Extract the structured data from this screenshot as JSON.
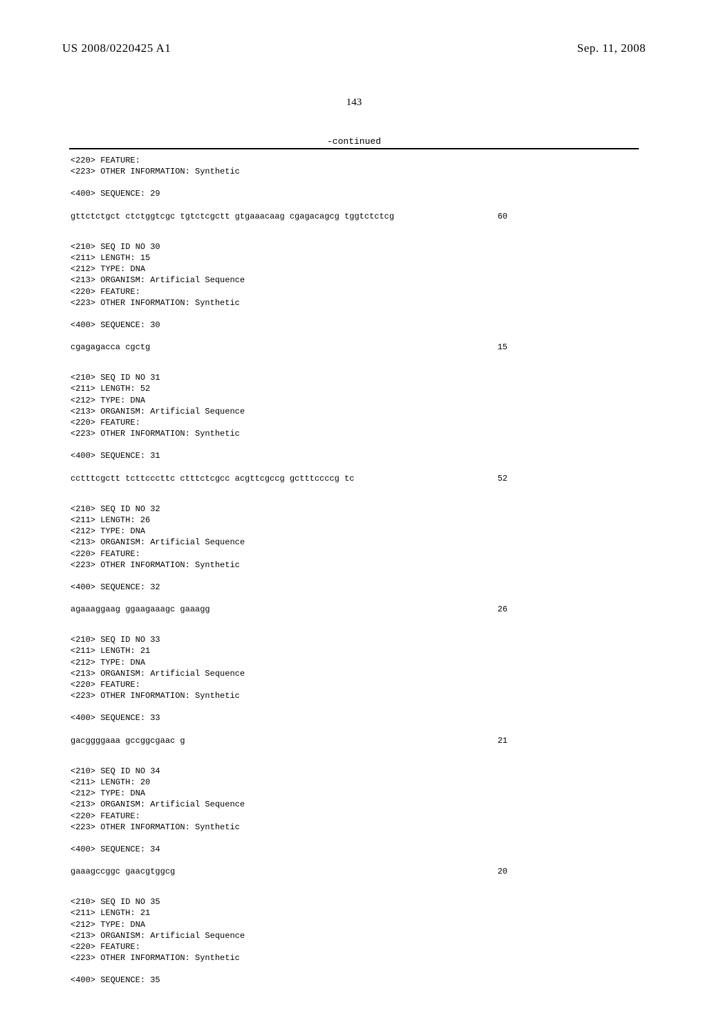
{
  "header": {
    "publication_number": "US 2008/0220425 A1",
    "publication_date": "Sep. 11, 2008"
  },
  "page_number": "143",
  "continued_label": "-continued",
  "seq29": {
    "feature": "<220> FEATURE:",
    "other_info": "<223> OTHER INFORMATION: Synthetic",
    "seq_label": "<400> SEQUENCE: 29",
    "sequence": "gttctctgct ctctggtcgc tgtctcgctt gtgaaacaag cgagacagcg tggtctctcg",
    "length": "60"
  },
  "seq30": {
    "id": "<210> SEQ ID NO 30",
    "len": "<211> LENGTH: 15",
    "type": "<212> TYPE: DNA",
    "org": "<213> ORGANISM: Artificial Sequence",
    "feature": "<220> FEATURE:",
    "other": "<223> OTHER INFORMATION: Synthetic",
    "seq_label": "<400> SEQUENCE: 30",
    "sequence": "cgagagacca cgctg",
    "length": "15"
  },
  "seq31": {
    "id": "<210> SEQ ID NO 31",
    "len": "<211> LENGTH: 52",
    "type": "<212> TYPE: DNA",
    "org": "<213> ORGANISM: Artificial Sequence",
    "feature": "<220> FEATURE:",
    "other": "<223> OTHER INFORMATION: Synthetic",
    "seq_label": "<400> SEQUENCE: 31",
    "sequence": "cctttcgctt tcttcccttc ctttctcgcc acgttcgccg gctttccccg tc",
    "length": "52"
  },
  "seq32": {
    "id": "<210> SEQ ID NO 32",
    "len": "<211> LENGTH: 26",
    "type": "<212> TYPE: DNA",
    "org": "<213> ORGANISM: Artificial Sequence",
    "feature": "<220> FEATURE:",
    "other": "<223> OTHER INFORMATION: Synthetic",
    "seq_label": "<400> SEQUENCE: 32",
    "sequence": "agaaaggaag ggaagaaagc gaaagg",
    "length": "26"
  },
  "seq33": {
    "id": "<210> SEQ ID NO 33",
    "len": "<211> LENGTH: 21",
    "type": "<212> TYPE: DNA",
    "org": "<213> ORGANISM: Artificial Sequence",
    "feature": "<220> FEATURE:",
    "other": "<223> OTHER INFORMATION: Synthetic",
    "seq_label": "<400> SEQUENCE: 33",
    "sequence": "gacggggaaa gccggcgaac g",
    "length": "21"
  },
  "seq34": {
    "id": "<210> SEQ ID NO 34",
    "len": "<211> LENGTH: 20",
    "type": "<212> TYPE: DNA",
    "org": "<213> ORGANISM: Artificial Sequence",
    "feature": "<220> FEATURE:",
    "other": "<223> OTHER INFORMATION: Synthetic",
    "seq_label": "<400> SEQUENCE: 34",
    "sequence": "gaaagccggc gaacgtggcg",
    "length": "20"
  },
  "seq35": {
    "id": "<210> SEQ ID NO 35",
    "len": "<211> LENGTH: 21",
    "type": "<212> TYPE: DNA",
    "org": "<213> ORGANISM: Artificial Sequence",
    "feature": "<220> FEATURE:",
    "other": "<223> OTHER INFORMATION: Synthetic",
    "seq_label": "<400> SEQUENCE: 35"
  }
}
